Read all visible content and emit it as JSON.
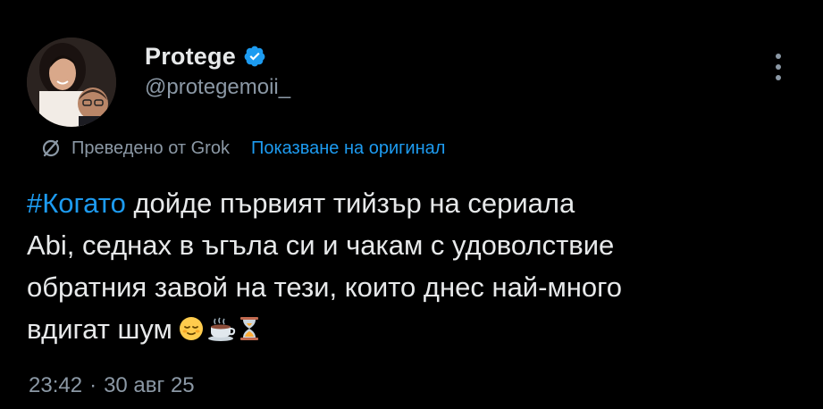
{
  "author": {
    "display_name": "Protege",
    "username": "@protegemoii_",
    "verified_icon": "verified-badge-icon",
    "avatar_icon": "avatar"
  },
  "translation": {
    "translated_label": "Преведено от Grok",
    "show_original_label": "Показване на оригинал"
  },
  "tweet": {
    "hashtag": "#Когато",
    "text": " дойде първият тийзър на сериала\nAbi, седнах в ъгъла си и чакам с удоволствие\nобратния завой на тези, които днес най-много\nвдигат шум",
    "emojis": [
      "relieved-face-icon",
      "hot-beverage-icon",
      "hourglass-icon"
    ]
  },
  "meta": {
    "time": "23:42",
    "separator": "·",
    "date": "30 авг 25"
  },
  "colors": {
    "background": "#000000",
    "text": "#e7e9ea",
    "secondary": "#8b98a5",
    "accent": "#1d9bf0"
  }
}
